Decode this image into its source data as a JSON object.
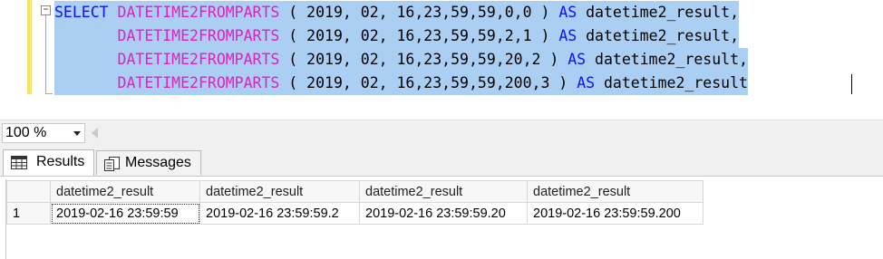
{
  "editor": {
    "fold_symbol": "−",
    "lines": [
      {
        "segments": [
          {
            "t": "SELECT",
            "c": "kw"
          },
          {
            "t": " ",
            "c": ""
          },
          {
            "t": "DATETIME2FROMPARTS",
            "c": "fn"
          },
          {
            "t": " ( 2019, 02, 16,23,59,59,0,0 ) ",
            "c": ""
          },
          {
            "t": "AS",
            "c": "kw"
          },
          {
            "t": " datetime2_result,",
            "c": ""
          }
        ]
      },
      {
        "segments": [
          {
            "t": "       ",
            "c": ""
          },
          {
            "t": "DATETIME2FROMPARTS",
            "c": "fn"
          },
          {
            "t": " ( 2019, 02, 16,23,59,59,2,1 ) ",
            "c": ""
          },
          {
            "t": "AS",
            "c": "kw"
          },
          {
            "t": " datetime2_result,",
            "c": ""
          }
        ]
      },
      {
        "segments": [
          {
            "t": "       ",
            "c": ""
          },
          {
            "t": "DATETIME2FROMPARTS",
            "c": "fn"
          },
          {
            "t": " ( 2019, 02, 16,23,59,59,20,2 ) ",
            "c": ""
          },
          {
            "t": "AS",
            "c": "kw"
          },
          {
            "t": " datetime2_result,",
            "c": ""
          }
        ]
      },
      {
        "segments": [
          {
            "t": "       ",
            "c": ""
          },
          {
            "t": "DATETIME2FROMPARTS",
            "c": "fn"
          },
          {
            "t": " ( 2019, 02, 16,23,59,59,200,3 ) ",
            "c": ""
          },
          {
            "t": "AS",
            "c": "kw"
          },
          {
            "t": " datetime2_result",
            "c": ""
          }
        ]
      }
    ]
  },
  "zoom": {
    "value": "100 %"
  },
  "tabs": [
    {
      "label": "Results",
      "icon": "grid-icon"
    },
    {
      "label": "Messages",
      "icon": "messages-icon"
    }
  ],
  "results": {
    "columns": [
      "datetime2_result",
      "datetime2_result",
      "datetime2_result",
      "datetime2_result"
    ],
    "rows": [
      {
        "num": "1",
        "cells": [
          "2019-02-16 23:59:59",
          "2019-02-16 23:59:59.2",
          "2019-02-16 23:59:59.20",
          "2019-02-16 23:59:59.200"
        ]
      }
    ]
  }
}
